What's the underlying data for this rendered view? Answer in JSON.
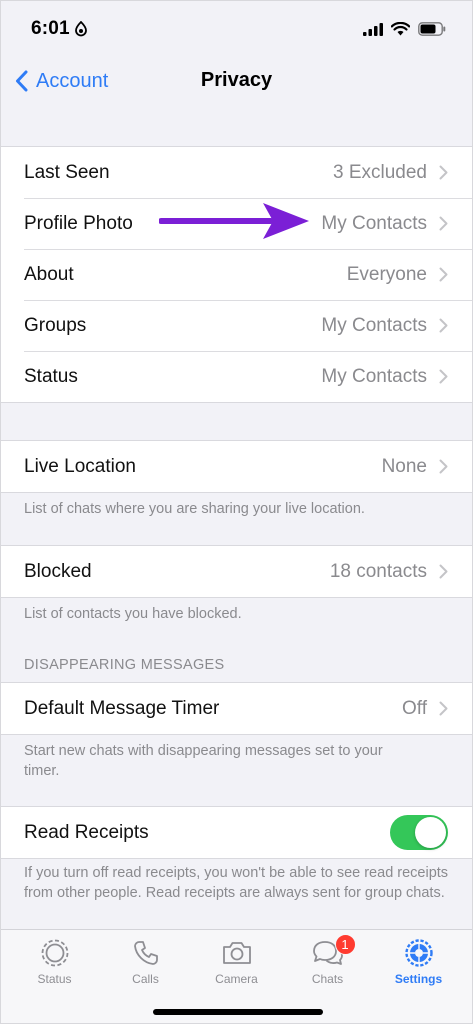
{
  "status_bar": {
    "time": "6:01",
    "icons": [
      "whatsapp-status-icon",
      "cellular-signal-icon",
      "wifi-icon",
      "battery-icon"
    ]
  },
  "nav": {
    "back_label": "Account",
    "title": "Privacy"
  },
  "group1": [
    {
      "label": "Last Seen",
      "value": "3 Excluded"
    },
    {
      "label": "Profile Photo",
      "value": "My Contacts"
    },
    {
      "label": "About",
      "value": "Everyone"
    },
    {
      "label": "Groups",
      "value": "My Contacts"
    },
    {
      "label": "Status",
      "value": "My Contacts"
    }
  ],
  "live_location": {
    "label": "Live Location",
    "value": "None",
    "footnote": "List of chats where you are sharing your live location."
  },
  "blocked": {
    "label": "Blocked",
    "value": "18 contacts",
    "footnote": "List of contacts you have blocked."
  },
  "disappearing": {
    "header": "DISAPPEARING MESSAGES",
    "label": "Default Message Timer",
    "value": "Off",
    "footnote": "Start new chats with disappearing messages set to your timer."
  },
  "read_receipts": {
    "label": "Read Receipts",
    "enabled": true,
    "footnote": "If you turn off read receipts, you won't be able to see read receipts from other people. Read receipts are always sent for group chats."
  },
  "tabs": [
    {
      "label": "Status",
      "icon": "status-icon",
      "active": false
    },
    {
      "label": "Calls",
      "icon": "phone-icon",
      "active": false
    },
    {
      "label": "Camera",
      "icon": "camera-icon",
      "active": false
    },
    {
      "label": "Chats",
      "icon": "chat-bubbles-icon",
      "active": false,
      "badge": "1"
    },
    {
      "label": "Settings",
      "icon": "gear-icon",
      "active": true
    }
  ],
  "colors": {
    "accent": "#2f7cf6",
    "toggle_on": "#34c759",
    "badge": "#ff3b30",
    "annotation_arrow": "#7b1fd6"
  }
}
